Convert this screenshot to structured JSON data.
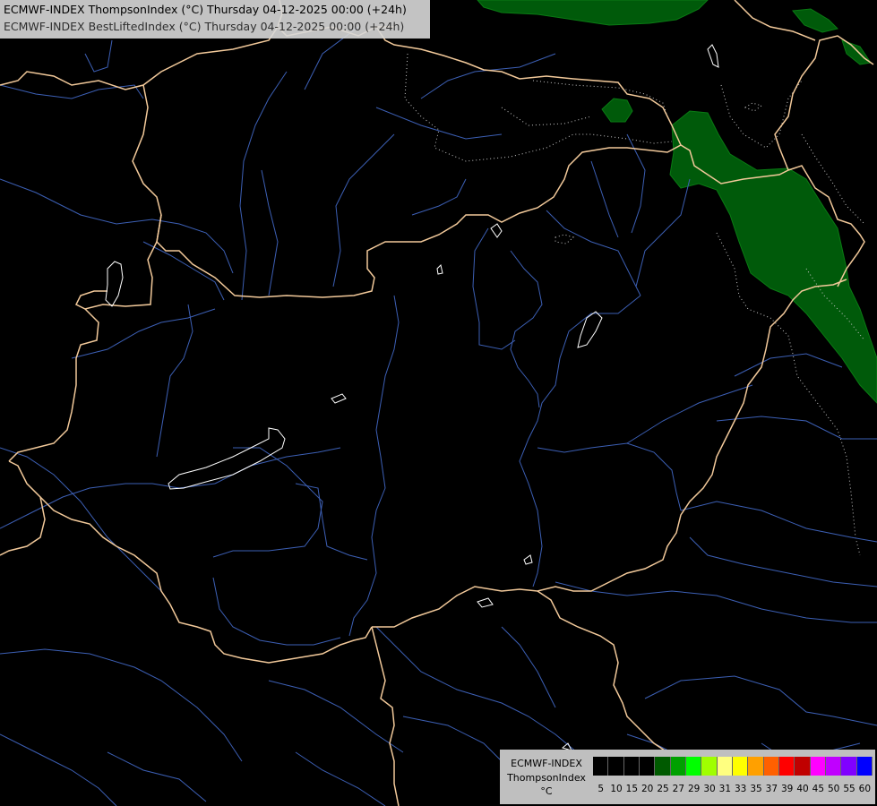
{
  "title": {
    "line1": "ECMWF-INDEX ThompsonIndex (°C) Thursday 04-12-2025 00:00 (+24h)",
    "line2": "ECMWF-INDEX BestLiftedIndex (°C) Thursday 04-12-2025 00:00 (+24h)"
  },
  "legend": {
    "line1": "ECMWF-INDEX",
    "line2": "ThompsonIndex",
    "line3": "°C",
    "colors": [
      "#000000",
      "#000000",
      "#000000",
      "#000000",
      "#005a00",
      "#00a000",
      "#00ff00",
      "#a0ff00",
      "#ffff80",
      "#ffff00",
      "#ffa000",
      "#ff6000",
      "#ff0000",
      "#c00000",
      "#ff00ff",
      "#c000ff",
      "#8000ff",
      "#0000ff"
    ],
    "ticks": [
      "5",
      "10",
      "15",
      "20",
      "25",
      "27",
      "29",
      "30",
      "31",
      "33",
      "35",
      "37",
      "39",
      "40",
      "45",
      "50",
      "55",
      "60"
    ]
  },
  "colors": {
    "background": "#000000",
    "borders": "#f2c99a",
    "rivers": "#3c5fb4",
    "lakes": "#ffffff",
    "index_fill": "#005a0a",
    "isolines": "#c8c8c8"
  }
}
